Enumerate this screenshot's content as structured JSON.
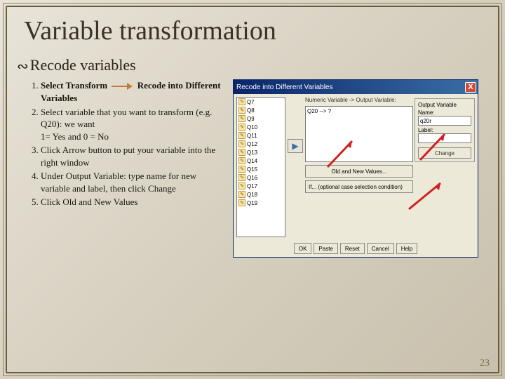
{
  "slide": {
    "title": "Variable transformation",
    "subtitle": "Recode variables",
    "page_number": "23"
  },
  "instructions": {
    "item1_pre": "Select Transform",
    "item1_post": "Recode into Different Variables",
    "item2": "Select variable that you want to transform (e.g. Q20): we want",
    "item2b": "1= Yes and 0 = No",
    "item3": "Click Arrow button to put your variable into the right window",
    "item4": "Under Output Variable: type name for new variable and label, then click Change",
    "item5": "Click Old and New Values"
  },
  "dialog": {
    "title": "Recode into Different Variables",
    "close": "X",
    "variables": [
      "Q7",
      "Q8",
      "Q9",
      "Q10",
      "Q11",
      "Q12",
      "Q13",
      "Q14",
      "Q15",
      "Q16",
      "Q17",
      "Q18",
      "Q19"
    ],
    "panel_label": "Numeric Variable -> Output Variable:",
    "numeric_value": "Q20 --> ?",
    "arrow_btn": "▶",
    "old_new": "Old and New Values...",
    "if_btn": "If... (optional case selection condition)",
    "output_legend": "Output Variable",
    "name_label": "Name:",
    "name_value": "q20r",
    "label_label": "Label:",
    "label_value": "",
    "change_btn": "Change",
    "buttons": [
      "OK",
      "Paste",
      "Reset",
      "Cancel",
      "Help"
    ]
  }
}
